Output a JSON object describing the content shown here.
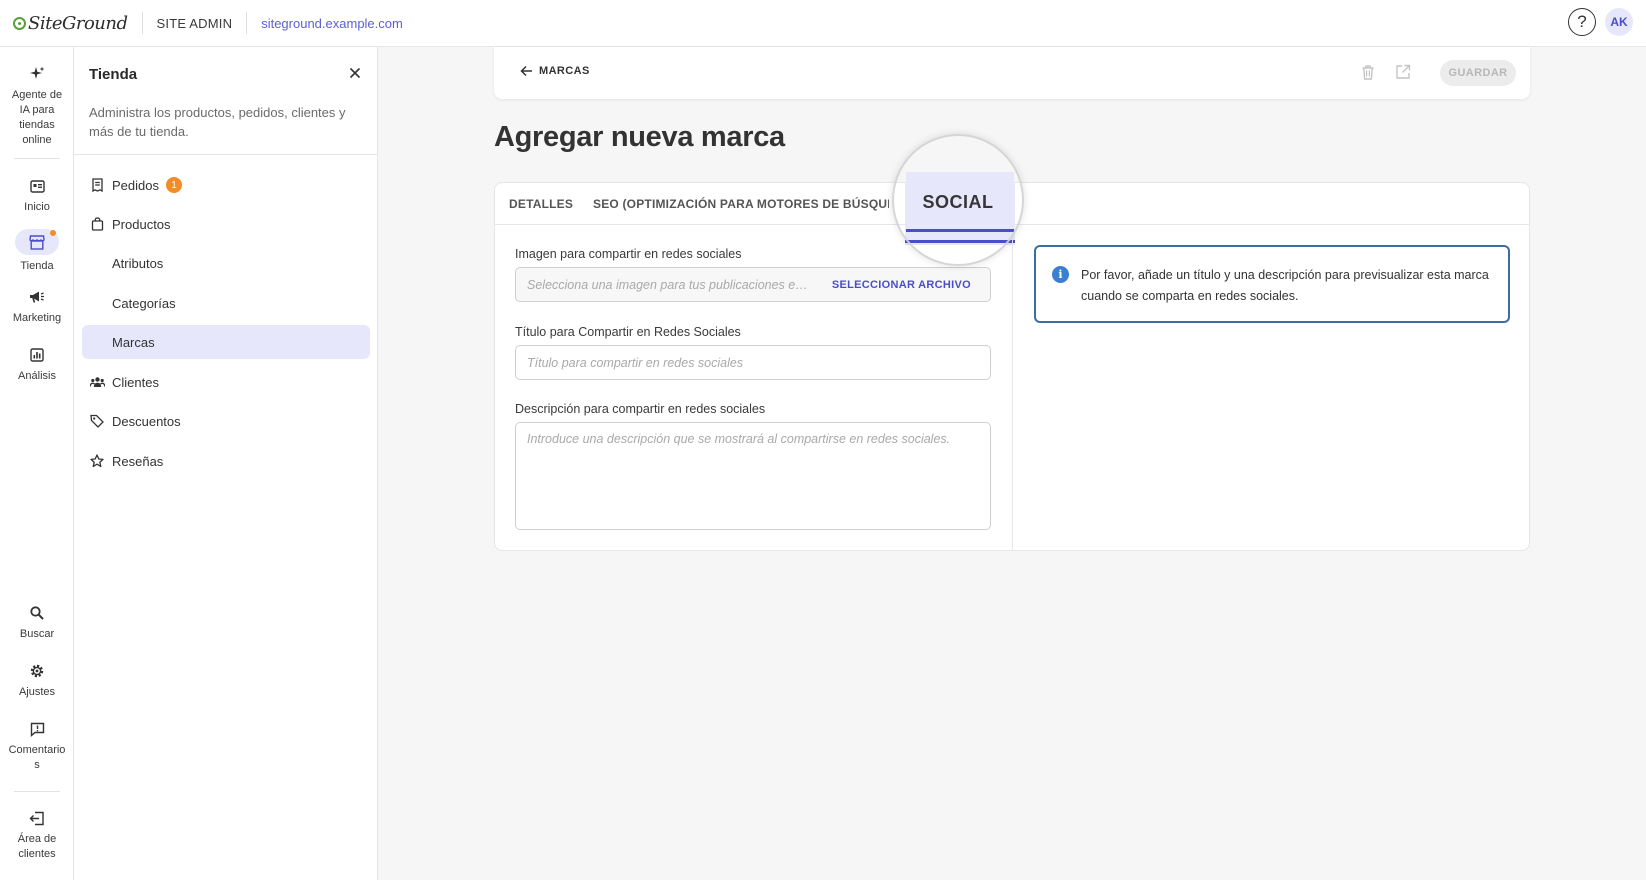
{
  "topbar": {
    "brand": "SiteGround",
    "section": "SITE ADMIN",
    "site_url": "siteground.example.com",
    "help_glyph": "?",
    "avatar_initials": "AK"
  },
  "rail": {
    "items": [
      {
        "label": "Agente de IA para tiendas online",
        "icon": "sparkles-icon"
      },
      {
        "label": "Inicio",
        "icon": "dashboard-icon"
      },
      {
        "label": "Tienda",
        "icon": "store-icon"
      },
      {
        "label": "Marketing",
        "icon": "megaphone-icon"
      },
      {
        "label": "Análisis",
        "icon": "analytics-icon"
      },
      {
        "label": "Buscar",
        "icon": "search-icon"
      },
      {
        "label": "Ajustes",
        "icon": "gear-icon"
      },
      {
        "label": "Comentarios",
        "icon": "feedback-icon"
      },
      {
        "label": "Área de clientes",
        "icon": "logout-icon"
      }
    ]
  },
  "panel": {
    "title": "Tienda",
    "description": "Administra los productos, pedidos, clientes y más de tu tienda.",
    "items": [
      {
        "label": "Pedidos",
        "badge": "1"
      },
      {
        "label": "Productos"
      },
      {
        "label": "Atributos"
      },
      {
        "label": "Categorías"
      },
      {
        "label": "Marcas"
      },
      {
        "label": "Clientes"
      },
      {
        "label": "Descuentos"
      },
      {
        "label": "Reseñas"
      }
    ]
  },
  "header": {
    "back_label": "MARCAS",
    "save_label": "GUARDAR"
  },
  "page": {
    "title": "Agregar nueva marca"
  },
  "tabs": {
    "details": "DETALLES",
    "seo": "SEO (OPTIMIZACIÓN PARA MOTORES DE BÚSQUEDA)",
    "social": "SOCIAL"
  },
  "form": {
    "image_label": "Imagen para compartir en redes sociales",
    "image_placeholder": "Selecciona una imagen para tus publicaciones en redes sociales",
    "image_button": "SELECCIONAR ARCHIVO",
    "title_label": "Título para Compartir en Redes Sociales",
    "title_placeholder": "Título para compartir en redes sociales",
    "desc_label": "Descripción para compartir en redes sociales",
    "desc_placeholder": "Introduce una descripción que se mostrará al compartirse en redes sociales."
  },
  "info": {
    "text": "Por favor, añade un título y una descripción para previsualizar esta marca cuando se comparta en redes sociales."
  },
  "colors": {
    "accent": "#4a4dc9",
    "accent_light": "#e6e7fb",
    "badge": "#f28c28",
    "info_border": "#3b6ea5"
  }
}
